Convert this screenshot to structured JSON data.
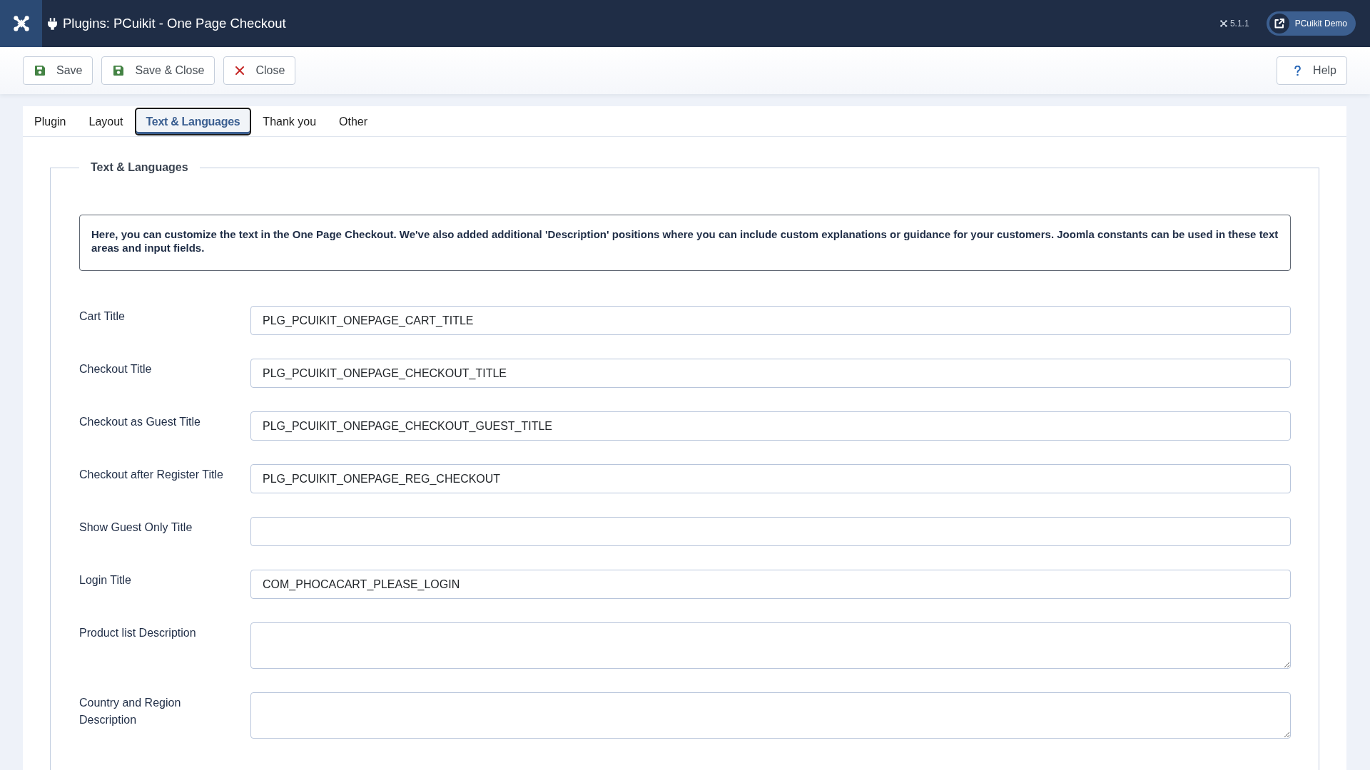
{
  "header": {
    "title": "Plugins: PCuikit - One Page Checkout",
    "version": "5.1.1",
    "site_button": "PCuikit Demo"
  },
  "toolbar": {
    "buttons": [
      {
        "label": "Save",
        "kind": "save"
      },
      {
        "label": "Save & Close",
        "kind": "save"
      },
      {
        "label": "Close",
        "kind": "close"
      }
    ],
    "help": {
      "label": "Help"
    }
  },
  "tabs": [
    {
      "label": "Plugin",
      "selected": false
    },
    {
      "label": "Layout",
      "selected": false
    },
    {
      "label": "Text & Languages",
      "selected": true
    },
    {
      "label": "Thank you",
      "selected": false
    },
    {
      "label": "Other",
      "selected": false
    }
  ],
  "fieldset": {
    "legend": "Text & Languages",
    "note": "Here, you can customize the text in the One Page Checkout. We've also added additional 'Description' positions where you can include custom explanations or guidance for your customers. Joomla constants can be used in these text areas and input fields.",
    "fields": [
      {
        "label": "Cart Title",
        "kind": "input",
        "value": "PLG_PCUIKIT_ONEPAGE_CART_TITLE"
      },
      {
        "label": "Checkout Title",
        "kind": "input",
        "value": "PLG_PCUIKIT_ONEPAGE_CHECKOUT_TITLE"
      },
      {
        "label": "Checkout as Guest Title",
        "kind": "input",
        "value": "PLG_PCUIKIT_ONEPAGE_CHECKOUT_GUEST_TITLE"
      },
      {
        "label": "Checkout after Register Title",
        "kind": "input",
        "value": "PLG_PCUIKIT_ONEPAGE_REG_CHECKOUT"
      },
      {
        "label": "Show Guest Only Title",
        "kind": "input"
      },
      {
        "label": "Login Title",
        "kind": "input",
        "value": "COM_PHOCACART_PLEASE_LOGIN"
      },
      {
        "label": "Product list Description",
        "kind": "textarea"
      },
      {
        "label": "Country and Region Description",
        "kind": "textarea"
      }
    ]
  }
}
